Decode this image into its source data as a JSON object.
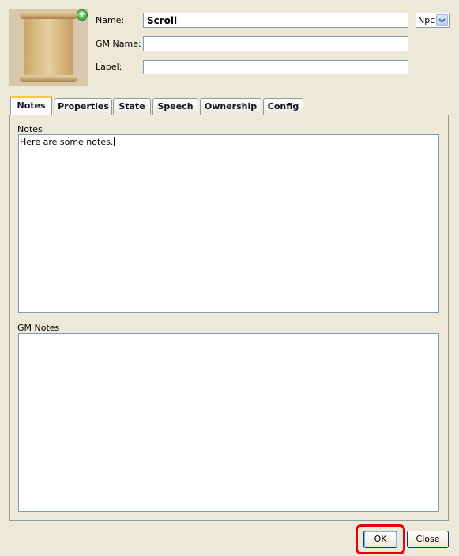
{
  "header": {
    "name_label": "Name:",
    "name_value": "Scroll",
    "gm_name_label": "GM Name:",
    "gm_name_value": "",
    "label_label": "Label:",
    "label_value": "",
    "type_value": "Npc",
    "add_icon_glyph": "+"
  },
  "tabs": [
    {
      "label": "Notes",
      "active": true
    },
    {
      "label": "Properties"
    },
    {
      "label": "State"
    },
    {
      "label": "Speech"
    },
    {
      "label": "Ownership"
    },
    {
      "label": "Config"
    }
  ],
  "notes_panel": {
    "notes_label": "Notes",
    "notes_value": "Here are some notes.",
    "gm_notes_label": "GM Notes",
    "gm_notes_value": ""
  },
  "footer": {
    "ok_label": "OK",
    "close_label": "Close"
  },
  "colors": {
    "dialog_bg": "#ECE9D8",
    "active_tab_accent": "#FFC83C",
    "highlight": "#E8000D"
  },
  "icons": {
    "token_image": "scroll-image",
    "add_image": "add-image-icon",
    "dropdown": "chevron-down-icon"
  }
}
